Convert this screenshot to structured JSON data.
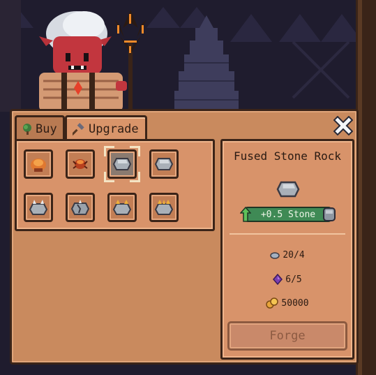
{
  "tabs": [
    {
      "label": "Buy",
      "icon": "tree-icon"
    },
    {
      "label": "Upgrade",
      "icon": "hammer-icon"
    }
  ],
  "active_tab": "Upgrade",
  "items": [
    {
      "icon": "fire-ore-icon",
      "selected": false
    },
    {
      "icon": "lava-spider-icon",
      "selected": false
    },
    {
      "icon": "stone-rock-icon",
      "selected": true
    },
    {
      "icon": "stone-rock-icon",
      "selected": false
    },
    {
      "icon": "spiky-stone-icon",
      "selected": false
    },
    {
      "icon": "cracked-stone-icon",
      "selected": false
    },
    {
      "icon": "gold-spiky-stone-icon",
      "selected": false
    },
    {
      "icon": "gold-spiky-stone-icon",
      "selected": false
    }
  ],
  "details": {
    "name": "Fused Stone Rock",
    "stat": "+0.5 Stone",
    "requirements": {
      "stone": "20/4",
      "gems": "6/5",
      "gold": "50000"
    },
    "forge_label": "Forge"
  },
  "colors": {
    "panel": "#c98a5e",
    "outline": "#3b2418",
    "stat_badge": "#3f8a55",
    "gem": "#7a3fb0",
    "gold": "#e8a43a"
  }
}
